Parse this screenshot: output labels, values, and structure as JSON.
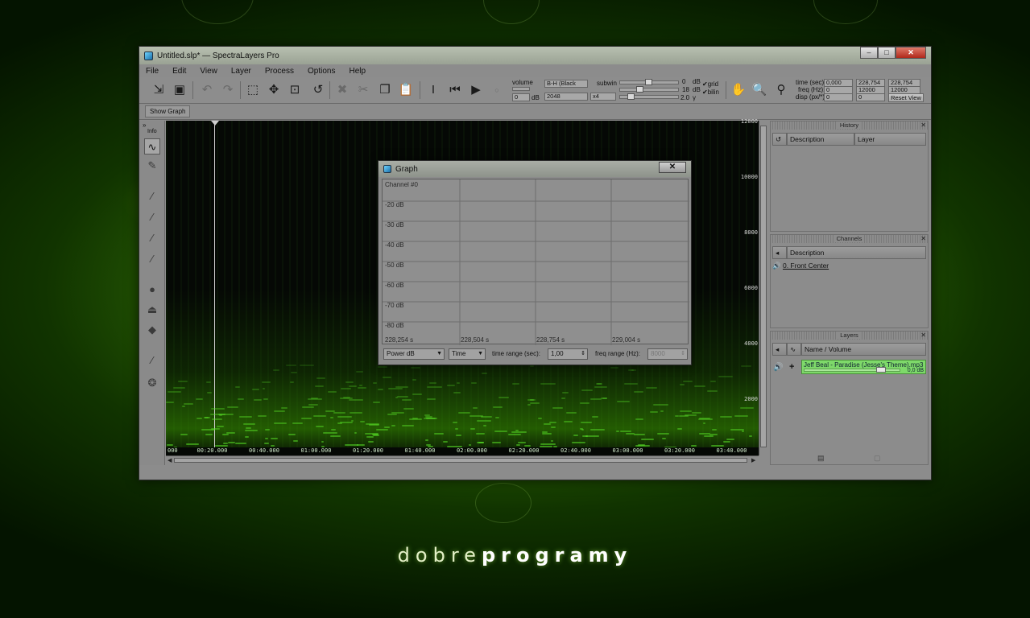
{
  "window": {
    "title": "Untitled.slp* — SpectraLayers Pro",
    "controls": [
      "–",
      "□",
      "✕"
    ]
  },
  "menu": [
    "File",
    "Edit",
    "View",
    "Layer",
    "Process",
    "Options",
    "Help"
  ],
  "toolbar": {
    "volume_label": "volume",
    "volume_value": "0",
    "volume_unit": "dB",
    "colormap": "B-H (Black",
    "fft_size": "2048",
    "subwin_label": "subwin",
    "subwin_value": "x4",
    "slider1_value": "0",
    "slider1_unit": "dB",
    "slider2_value": "18",
    "slider2_unit": "dB",
    "slider3_value": "2.0",
    "slider3_unit": "γ",
    "grid_label": "grid",
    "bilin_label": "bilin",
    "time_label": "time (sec):",
    "freq_label": "freq (Hz):",
    "disp_label": "disp (px/*):",
    "time_from": "0,000",
    "time_to": "228,754",
    "time_len": "228,754",
    "freq_from": "0",
    "freq_to": "12000",
    "freq_len": "12000",
    "disp_a": "0",
    "disp_b": "0",
    "reset_view": "Reset View"
  },
  "show_graph": "Show Graph",
  "tools_label": "Info",
  "spectrogram": {
    "time_ticks": [
      "000",
      "00:20.000",
      "00:40.000",
      "01:00.000",
      "01:20.000",
      "01:40.000",
      "02:00.000",
      "02:20.000",
      "02:40.000",
      "03:00.000",
      "03:20.000",
      "03:40.000"
    ],
    "freq_ticks": [
      "12000",
      "10000",
      "8000",
      "6000",
      "4000",
      "2000"
    ]
  },
  "history": {
    "title": "History",
    "col_description": "Description",
    "col_layer": "Layer"
  },
  "channels": {
    "title": "Channels",
    "col_description": "Description",
    "items": [
      "0. Front Center"
    ]
  },
  "layers": {
    "title": "Layers",
    "col_name": "Name / Volume",
    "items": [
      {
        "name": "Jeff Beal - Paradise (Jesse's Theme).mp3",
        "volume": "0,0",
        "unit": "dB"
      }
    ]
  },
  "graph": {
    "title": "Graph",
    "close": "✕",
    "channel": "Channel #0",
    "y_labels": [
      "-20 dB",
      "-30 dB",
      "-40 dB",
      "-50 dB",
      "-60 dB",
      "-70 dB",
      "-80 dB"
    ],
    "x_labels": [
      "228,254 s",
      "228,504 s",
      "228,754 s",
      "229,004 s"
    ],
    "mode": "Power dB",
    "axis": "Time",
    "time_range_label": "time range (sec):",
    "time_range_value": "1,00",
    "freq_range_label": "freq range (Hz):",
    "freq_range_value": "8000"
  },
  "wallpaper": {
    "brand_light": "dobre",
    "brand_bold": "programy"
  }
}
